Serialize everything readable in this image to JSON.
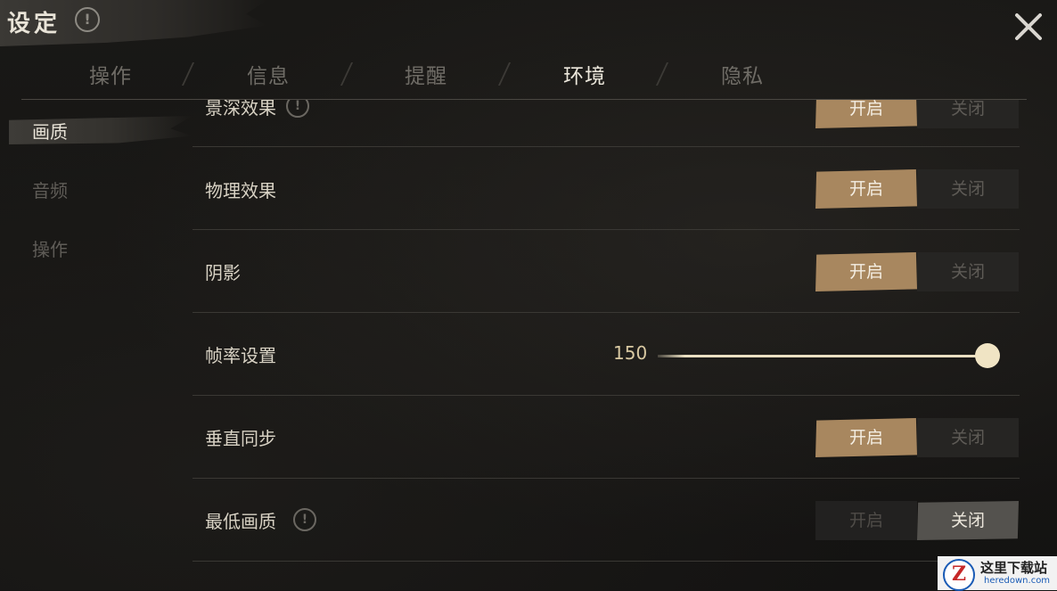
{
  "header": {
    "title": "设定",
    "info_glyph": "!",
    "close_glyph": "✕"
  },
  "tabs": [
    {
      "label": "操作",
      "active": false
    },
    {
      "label": "信息",
      "active": false
    },
    {
      "label": "提醒",
      "active": false
    },
    {
      "label": "环境",
      "active": true
    },
    {
      "label": "隐私",
      "active": false
    }
  ],
  "sidebar": {
    "items": [
      {
        "label": "画质",
        "active": true
      },
      {
        "label": "音频",
        "active": false
      },
      {
        "label": "操作",
        "active": false
      }
    ]
  },
  "settings": {
    "depth_of_field": {
      "label": "景深效果",
      "on_label": "开启",
      "off_label": "关闭",
      "value": "on"
    },
    "physics": {
      "label": "物理效果",
      "on_label": "开启",
      "off_label": "关闭",
      "value": "on"
    },
    "shadow": {
      "label": "阴影",
      "on_label": "开启",
      "off_label": "关闭",
      "value": "on"
    },
    "frame_rate": {
      "label": "帧率设置",
      "value": "150",
      "level": 1.0
    },
    "vsync": {
      "label": "垂直同步",
      "on_label": "开启",
      "off_label": "关闭",
      "value": "on"
    },
    "lowest_quality": {
      "label": "最低画质",
      "on_label": "开启",
      "off_label": "关闭",
      "value": "off"
    }
  },
  "watermark": {
    "logo": "Z",
    "name": "这里下载站",
    "url": "heredown.com"
  },
  "colors": {
    "accent": "#a8875f",
    "text": "#d8d2c4",
    "background": "#151413"
  },
  "icons": {
    "close": "close-icon",
    "info": "info-icon"
  }
}
